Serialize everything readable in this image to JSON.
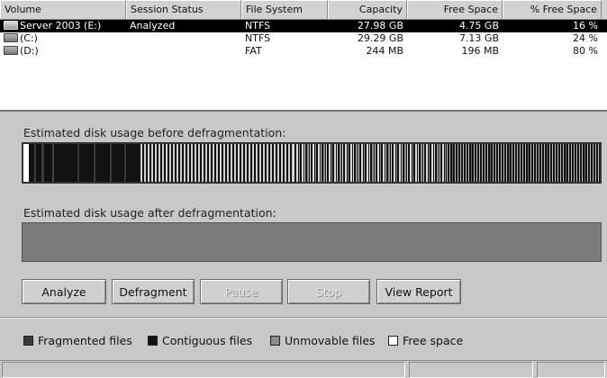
{
  "columns": [
    "Volume",
    "Session Status",
    "File System",
    "Capacity",
    "Free Space",
    "% Free Space"
  ],
  "volumes": [
    {
      "name": "Server 2003 (E:)",
      "status": "Analyzed",
      "fs": "NTFS",
      "capacity": "27.98 GB",
      "free": "4.75 GB",
      "pct": "16 %",
      "selected": true
    },
    {
      "name": "(C:)",
      "status": "",
      "fs": "NTFS",
      "capacity": "29.29 GB",
      "free": "7.13 GB",
      "pct": "24 %",
      "selected": false
    },
    {
      "name": "(D:)",
      "status": "",
      "fs": "FAT",
      "capacity": "244 MB",
      "free": "196 MB",
      "pct": "80 %",
      "selected": false
    }
  ],
  "analysis": {
    "before_label": "Estimated disk usage before defragmentation:",
    "after_label": "Estimated disk usage after defragmentation:"
  },
  "buttons": {
    "analyze": "Analyze",
    "defragment": "Defragment",
    "pause": "Pause",
    "stop": "Stop",
    "view_report": "View Report"
  },
  "legend": {
    "fragmented": "Fragmented files",
    "contiguous": "Contiguous files",
    "unmovable": "Unmovable files",
    "free": "Free space"
  },
  "colors": {
    "fragmented": "#3a3a3a",
    "contiguous": "#111111",
    "unmovable": "#8c8c8c",
    "free": "#ffffff",
    "after_bar": "#7a7a7a"
  }
}
